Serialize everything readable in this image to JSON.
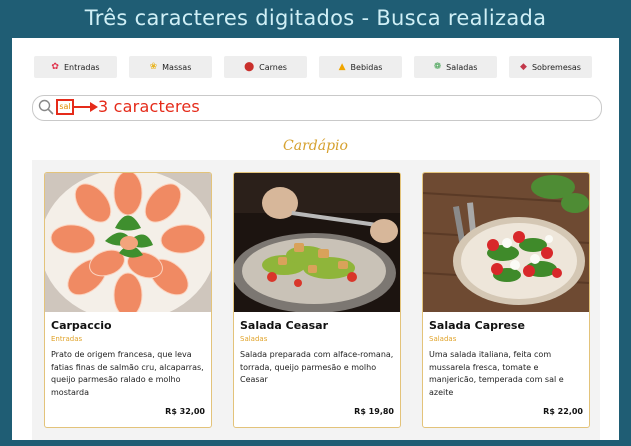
{
  "banner": {
    "title": "Três caracteres digitados - Busca realizada"
  },
  "categories": [
    {
      "label": "Entradas",
      "icon": "starter-icon"
    },
    {
      "label": "Massas",
      "icon": "pasta-icon"
    },
    {
      "label": "Carnes",
      "icon": "meat-icon"
    },
    {
      "label": "Bebidas",
      "icon": "drink-icon"
    },
    {
      "label": "Saladas",
      "icon": "salad-icon"
    },
    {
      "label": "Sobremesas",
      "icon": "dessert-icon"
    }
  ],
  "search": {
    "value": "sal"
  },
  "annotation": {
    "text": "3 caracteres"
  },
  "menu": {
    "title": "Cardápio",
    "items": [
      {
        "name": "Carpaccio",
        "category": "Entradas",
        "description": "Prato de origem francesa, que leva fatias finas de salmão cru, alcaparras, queijo parmesão ralado e molho mostarda",
        "price": "R$ 32,00"
      },
      {
        "name": "Salada Ceasar",
        "category": "Saladas",
        "description": "Salada preparada com alface-romana, torrada, queijo parmesão e molho Ceasar",
        "price": "R$ 19,80"
      },
      {
        "name": "Salada Caprese",
        "category": "Saladas",
        "description": "Uma salada italiana, feita com mussarela fresca, tomate e manjericão, temperada com sal e azeite",
        "price": "R$ 22,00"
      }
    ]
  },
  "colors": {
    "banner_bg": "#1f5d74",
    "annotation": "#e52b1a",
    "accent": "#e0a32a"
  }
}
